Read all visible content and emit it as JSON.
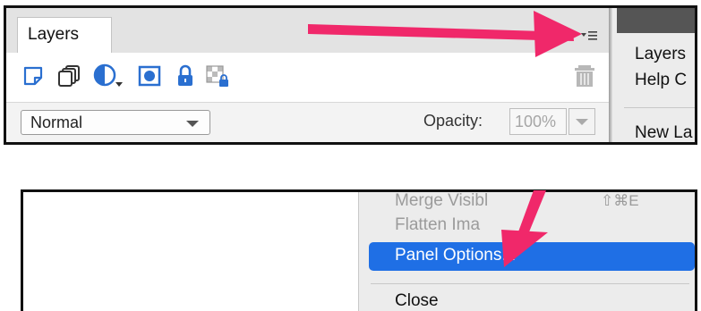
{
  "top_panel": {
    "tab_label": "Layers",
    "toolbar_icons": [
      "new-layer-icon",
      "group-icon",
      "adjustment-layer-icon",
      "mask-icon",
      "lock-icon",
      "lock-transparency-icon",
      "trash-icon"
    ],
    "blend_mode": "Normal",
    "opacity_label": "Opacity:",
    "opacity_value": "100%",
    "flyout_menu": {
      "items": [
        "Layers",
        "Help C",
        "New La"
      ]
    }
  },
  "bottom_panel": {
    "menu": {
      "merge_visible": "Merge Visibl",
      "merge_visible_shortcut": "⇧⌘E",
      "flatten_image": "Flatten Ima",
      "panel_options": "Panel Options...",
      "close": "Close"
    }
  },
  "colors": {
    "annotation_arrow": "#f0286a",
    "menu_highlight": "#1f6fe5",
    "panel_background": "#ececec"
  }
}
